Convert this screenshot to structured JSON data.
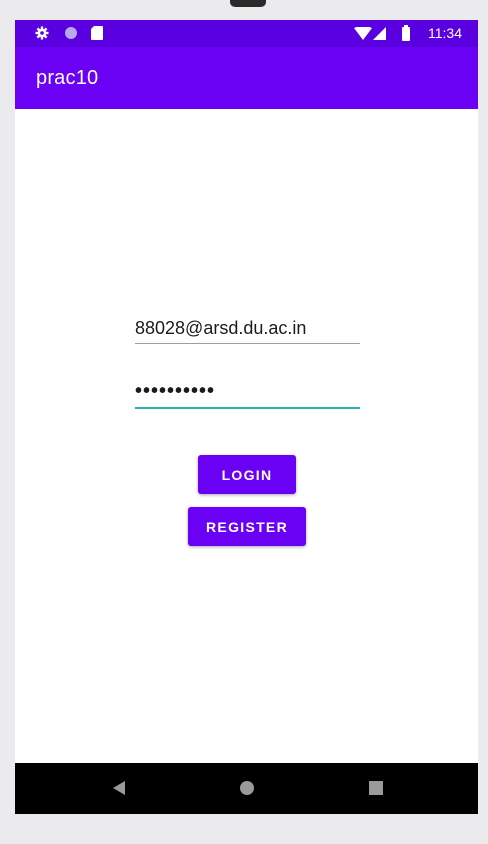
{
  "status_bar": {
    "time": "11:34",
    "left_icons": [
      "gear-icon",
      "circle-icon",
      "sd-card-icon"
    ],
    "right_icons": [
      "wifi-icon",
      "cell-signal-icon",
      "battery-icon"
    ]
  },
  "app_bar": {
    "title": "prac10"
  },
  "form": {
    "email_value": "88028@arsd.du.ac.in",
    "password_value": "••••••••••"
  },
  "buttons": {
    "login_label": "LOGIN",
    "register_label": "REGISTER"
  },
  "nav_bar": {
    "icons": [
      "back-icon",
      "home-icon",
      "recents-icon"
    ]
  },
  "colors": {
    "status_bar": "#5a00e0",
    "primary": "#6a00f4",
    "accent_underline": "#26b8a7",
    "nav_bar": "#000000"
  }
}
